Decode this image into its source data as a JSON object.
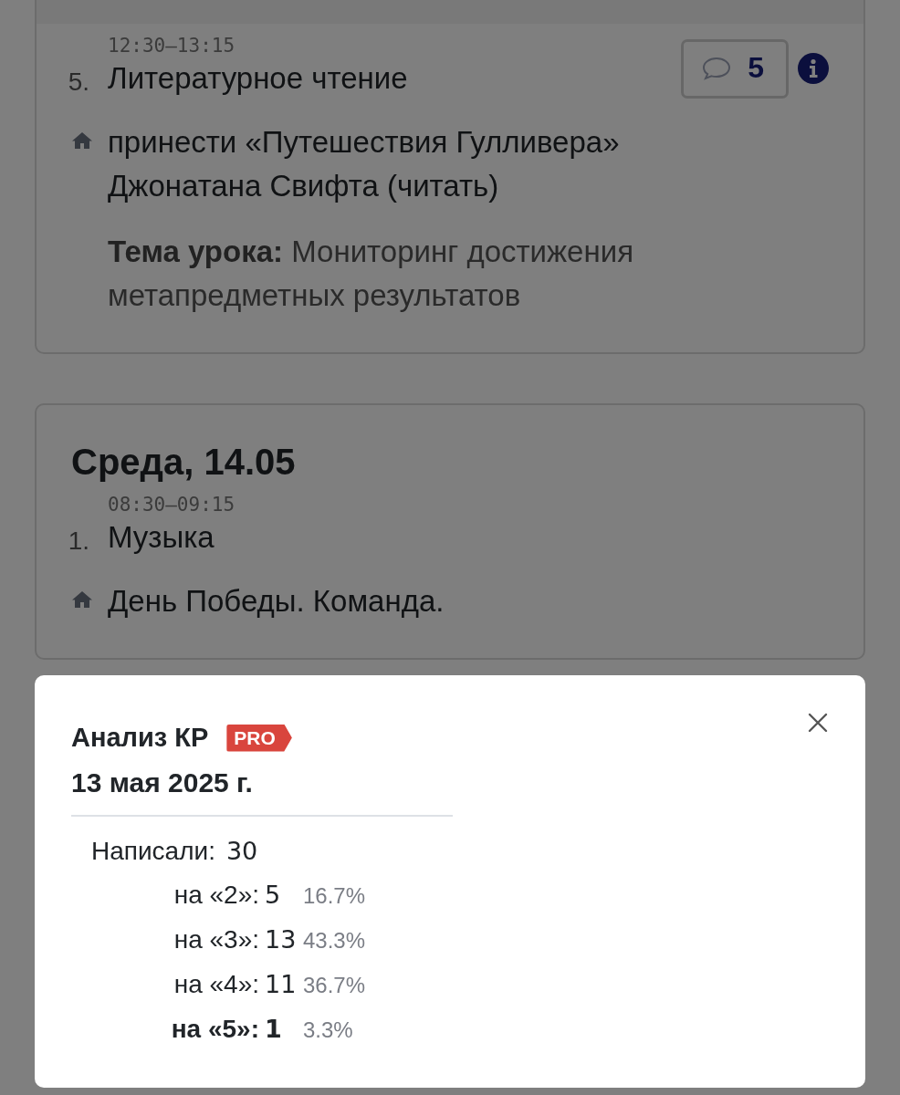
{
  "days": [
    {
      "lessons": [
        {
          "number": "5.",
          "time": "12:30–13:15",
          "subject": "Литературное чтение",
          "comments": "5",
          "info": true,
          "homework": "принести «Путешествия Гулливера» Джонатана Свифта (читать)",
          "topic_label": "Тема урока:",
          "topic": "Мониторинг достижения метапредметных результатов"
        }
      ]
    },
    {
      "title": "Среда, 14.05",
      "lessons": [
        {
          "number": "1.",
          "time": "08:30–09:15",
          "subject": "Музыка",
          "info": false,
          "homework": "День Победы. Команда."
        }
      ]
    }
  ],
  "dialog": {
    "title": "Анализ КР",
    "badge": "PRO",
    "date": "13 мая 2025 г.",
    "total_label": "Написали:",
    "total": "30",
    "rows": [
      {
        "label": "на «2»:",
        "count": "5",
        "percent": "16.7%",
        "emphasized": false
      },
      {
        "label": "на «3»:",
        "count": "13",
        "percent": "43.3%",
        "emphasized": false
      },
      {
        "label": "на «4»:",
        "count": "11",
        "percent": "36.7%",
        "emphasized": false
      },
      {
        "label": "на «5»:",
        "count": "1",
        "percent": "3.3%",
        "emphasized": true
      }
    ]
  }
}
